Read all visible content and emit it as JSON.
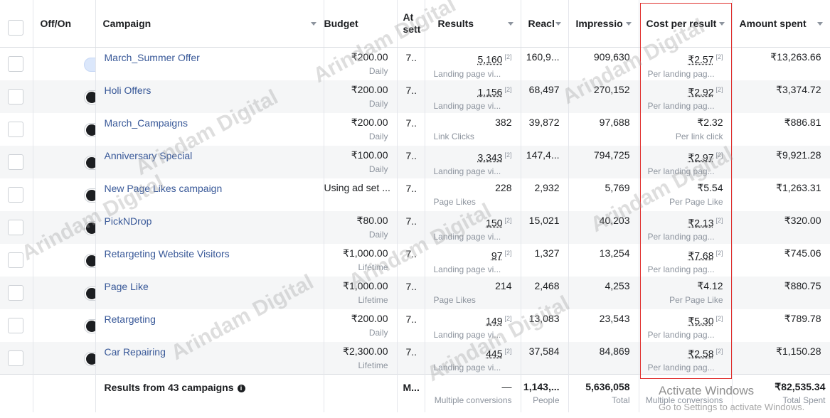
{
  "columns": {
    "offon": "Off/On",
    "campaign": "Campaign",
    "budget": "Budget",
    "attr": "At sett",
    "results": "Results",
    "reach": "Reacl",
    "impressions": "Impressio",
    "cpr": "Cost per result",
    "spent": "Amount spent"
  },
  "rows": [
    {
      "on": true,
      "name": "March_Summer Offer",
      "budget": "₹200.00",
      "budget_type": "Daily",
      "attr": "7..",
      "results": "5,160",
      "results_type": "Landing page vi...",
      "reach": "160,9...",
      "impressions": "909,630",
      "cpr": "₹2.57",
      "cpr_type": "Per landing pag...",
      "spent": "₹13,263.66",
      "marker": "[2]"
    },
    {
      "on": false,
      "name": "Holi Offers",
      "budget": "₹200.00",
      "budget_type": "Daily",
      "attr": "7..",
      "results": "1,156",
      "results_type": "Landing page vi...",
      "reach": "68,497",
      "impressions": "270,152",
      "cpr": "₹2.92",
      "cpr_type": "Per landing pag...",
      "spent": "₹3,374.72",
      "marker": "[2]"
    },
    {
      "on": false,
      "name": "March_Campaigns",
      "budget": "₹200.00",
      "budget_type": "Daily",
      "attr": "7..",
      "results": "382",
      "results_type": "Link Clicks",
      "reach": "39,872",
      "impressions": "97,688",
      "cpr": "₹2.32",
      "cpr_type": "Per link click",
      "spent": "₹886.81",
      "marker": ""
    },
    {
      "on": false,
      "name": "Anniversary Special",
      "budget": "₹100.00",
      "budget_type": "Daily",
      "attr": "7..",
      "results": "3,343",
      "results_type": "Landing page vi...",
      "reach": "147,4...",
      "impressions": "794,725",
      "cpr": "₹2.97",
      "cpr_type": "Per landing pag...",
      "spent": "₹9,921.28",
      "marker": "[2]"
    },
    {
      "on": false,
      "name": "New Page Likes campaign",
      "budget": "Using ad set ...",
      "budget_type": "",
      "attr": "7..",
      "results": "228",
      "results_type": "Page Likes",
      "reach": "2,932",
      "impressions": "5,769",
      "cpr": "₹5.54",
      "cpr_type": "Per Page Like",
      "spent": "₹1,263.31",
      "marker": ""
    },
    {
      "on": false,
      "name": "PickNDrop",
      "budget": "₹80.00",
      "budget_type": "Daily",
      "attr": "7..",
      "results": "150",
      "results_type": "Landing page vi...",
      "reach": "15,021",
      "impressions": "40,203",
      "cpr": "₹2.13",
      "cpr_type": "Per landing pag...",
      "spent": "₹320.00",
      "marker": "[2]"
    },
    {
      "on": false,
      "name": "Retargeting Website Visitors",
      "budget": "₹1,000.00",
      "budget_type": "Lifetime",
      "attr": "7..",
      "results": "97",
      "results_type": "Landing page vi...",
      "reach": "1,327",
      "impressions": "13,254",
      "cpr": "₹7.68",
      "cpr_type": "Per landing pag...",
      "spent": "₹745.06",
      "marker": "[2]"
    },
    {
      "on": false,
      "name": "Page Like",
      "budget": "₹1,000.00",
      "budget_type": "Lifetime",
      "attr": "7..",
      "results": "214",
      "results_type": "Page Likes",
      "reach": "2,468",
      "impressions": "4,253",
      "cpr": "₹4.12",
      "cpr_type": "Per Page Like",
      "spent": "₹880.75",
      "marker": ""
    },
    {
      "on": false,
      "name": "Retargeting",
      "budget": "₹200.00",
      "budget_type": "Daily",
      "attr": "7..",
      "results": "149",
      "results_type": "Landing page vi...",
      "reach": "13,083",
      "impressions": "23,543",
      "cpr": "₹5.30",
      "cpr_type": "Per landing pag...",
      "spent": "₹789.78",
      "marker": "[2]"
    },
    {
      "on": false,
      "name": "Car Repairing",
      "budget": "₹2,300.00",
      "budget_type": "Lifetime",
      "attr": "7..",
      "results": "445",
      "results_type": "Landing page vi...",
      "reach": "37,584",
      "impressions": "84,869",
      "cpr": "₹2.58",
      "cpr_type": "Per landing pag...",
      "spent": "₹1,150.28",
      "marker": "[2]"
    }
  ],
  "footer": {
    "label": "Results from 43 campaigns",
    "info": "i",
    "attr": "M...",
    "results": "—",
    "results_sub": "Multiple conversions",
    "reach": "1,143,...",
    "reach_sub": "People",
    "impressions": "5,636,058",
    "impressions_sub": "Total",
    "cpr_sub": "Multiple conversions",
    "spent": "₹82,535.34",
    "spent_sub": "Total Spent"
  },
  "watermark": "Arindam Digital",
  "windows_notice": {
    "title": "Activate Windows",
    "subtitle": "Go to Settings to activate Windows."
  },
  "colors": {
    "link": "#385898",
    "toggle_on": "#1877f2",
    "highlight_box": "#e0302e"
  }
}
